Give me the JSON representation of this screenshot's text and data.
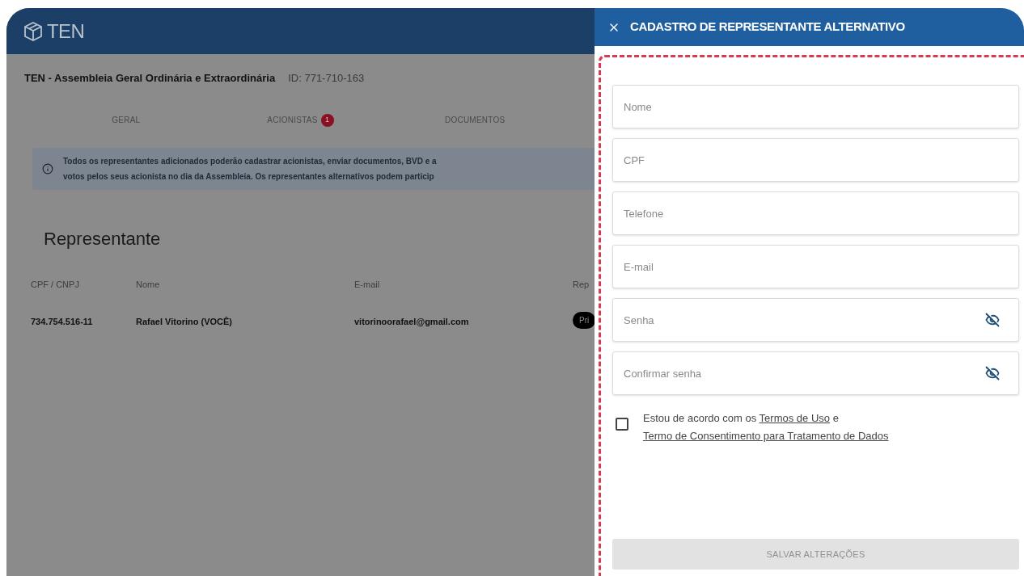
{
  "app_header": {
    "logo_text": "TEN"
  },
  "meeting": {
    "title": "TEN - Assembleia Geral Ordinária e Extraordinária",
    "id": "ID: 771-710-163"
  },
  "tabs": [
    {
      "label": "GERAL"
    },
    {
      "label": "ACIONISTAS",
      "badge": "1"
    },
    {
      "label": "DOCUMENTOS"
    }
  ],
  "info_lines": [
    "Todos os representantes adicionados poderão cadastrar acionistas, enviar documentos, BVD e a",
    "votos pelos seus acionista no dia da Assembleia. Os representantes alternativos podem particip"
  ],
  "section_title": "Representante",
  "table": {
    "columns": [
      "CPF / CNPJ",
      "Nome",
      "E-mail",
      "Rep"
    ],
    "rows": [
      {
        "cells": [
          "734.754.516-11",
          "Rafael Vitorino (VOCÊ)",
          "vitorinoorafael@gmail.com"
        ],
        "tag": "Pri"
      }
    ]
  },
  "drawer": {
    "title": "CADASTRO DE REPRESENTANTE ALTERNATIVO",
    "fields": [
      {
        "placeholder": "Nome",
        "kind": "text"
      },
      {
        "placeholder": "CPF",
        "kind": "text"
      },
      {
        "placeholder": "Telefone",
        "kind": "text"
      },
      {
        "placeholder": "E-mail",
        "kind": "text"
      },
      {
        "placeholder": "Senha",
        "kind": "password"
      },
      {
        "placeholder": "Confirmar senha",
        "kind": "password"
      }
    ],
    "consent": {
      "checked": false,
      "text_before": "Estou de acordo com os",
      "link_1": "Termos de Uso",
      "text_between": "e",
      "link_2": "Termo de Consentimento para Tratamento de Dados"
    },
    "submit": {
      "label": "SALVAR ALTERAÇÕES",
      "disabled": true
    }
  }
}
